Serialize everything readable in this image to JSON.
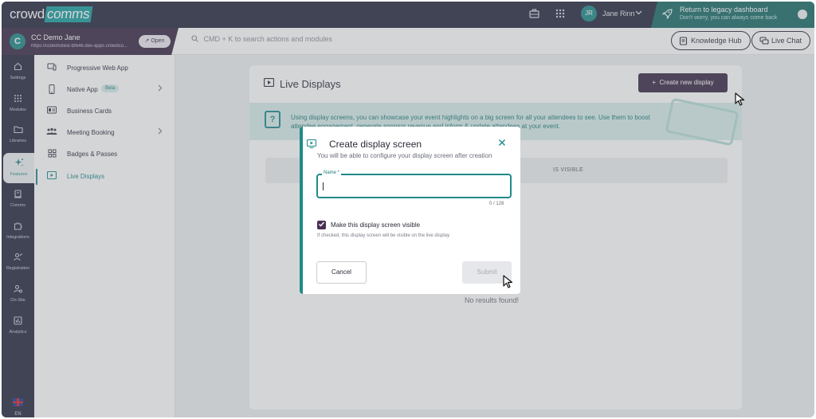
{
  "brand": {
    "part1": "crowd",
    "part2": "comms"
  },
  "user": {
    "initials": "JR",
    "name": "Jane Rinn"
  },
  "legacy": {
    "title": "Return to legacy dashboard",
    "subtitle": "Don't worry, you can always come back"
  },
  "event": {
    "initial": "C",
    "name": "CC Demo Jane",
    "url": "https://ccdemotest-bf646.dev-apps.crowdco...",
    "open_label": "Open"
  },
  "search": {
    "placeholder": "CMD + K to search actions and modules"
  },
  "header_buttons": {
    "knowledge_hub": "Knowledge Hub",
    "live_chat": "Live Chat"
  },
  "rail": [
    {
      "label": "Settings",
      "icon": "home-icon"
    },
    {
      "label": "Modules",
      "icon": "grid-icon"
    },
    {
      "label": "Libraries",
      "icon": "folder-icon"
    },
    {
      "label": "Features",
      "icon": "sparkle-icon"
    },
    {
      "label": "Comms",
      "icon": "comms-icon"
    },
    {
      "label": "Integrations",
      "icon": "puzzle-icon"
    },
    {
      "label": "Registration",
      "icon": "registration-icon"
    },
    {
      "label": "On-Site",
      "icon": "onsite-icon"
    },
    {
      "label": "Analytics",
      "icon": "analytics-icon"
    }
  ],
  "language": "EN",
  "subnav": [
    {
      "label": "Progressive Web App",
      "icon": "devices-icon"
    },
    {
      "label": "Native App",
      "icon": "phone-icon",
      "badge": "Beta"
    },
    {
      "label": "Business Cards",
      "icon": "business-card-icon"
    },
    {
      "label": "Meeting Booking",
      "icon": "people-icon"
    },
    {
      "label": "Badges & Passes",
      "icon": "badge-icon"
    },
    {
      "label": "Live Displays",
      "icon": "display-icon"
    }
  ],
  "page": {
    "title": "Live Displays",
    "create_button": "Create new display",
    "banner_text": "Using display screens, you can showcase your event highlights on a big screen for all your attendees to see. Use them to boost attendee engagement, generate sponsor revenue and inform & update attendees at your event.",
    "column_header": "IS VISIBLE",
    "empty_text": "No results found!"
  },
  "modal": {
    "title": "Create display screen",
    "subtitle": "You will be able to configure your display screen after creation",
    "name_label": "Name *",
    "char_counter": "0 / 128",
    "checkbox_label": "Make this display screen visible",
    "checkbox_checked": true,
    "checkbox_help": "If checked, this display screen will be visible on the live display",
    "cancel_label": "Cancel",
    "submit_label": "Submit"
  },
  "colors": {
    "navy": "#262a40",
    "teal": "#1f8a8a",
    "plum": "#3c2b47",
    "banner": "#d7eeec"
  }
}
